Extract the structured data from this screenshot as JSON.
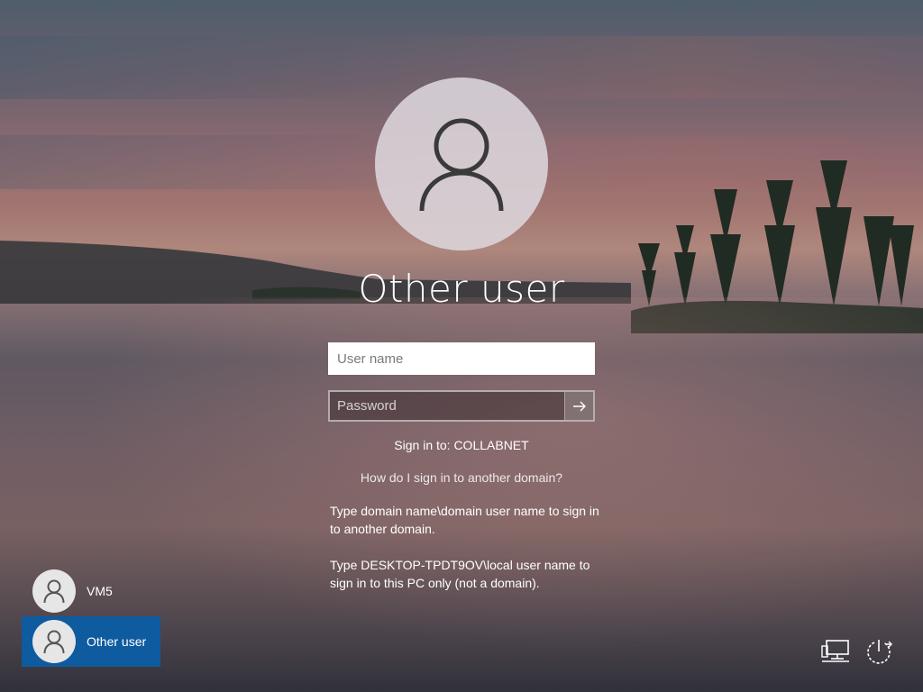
{
  "login": {
    "title": "Other user",
    "username_placeholder": "User name",
    "password_placeholder": "Password",
    "signin_to": "Sign in to: COLLABNET",
    "help_link": "How do I sign in to another domain?",
    "help_text_1": "Type domain name\\domain user name to sign in to another domain.",
    "help_text_2": "Type DESKTOP-TPDT9OV\\local user name to sign in to this PC only (not a domain)."
  },
  "users": [
    {
      "label": "VM5",
      "selected": false
    },
    {
      "label": "Other user",
      "selected": true
    }
  ],
  "icons": {
    "avatar": "user-silhouette-icon",
    "submit": "arrow-right-icon",
    "network": "network-icon",
    "power": "power-icon"
  },
  "colors": {
    "selected_tile": "#0f5ba0",
    "avatar_bg": "#dcd6dc"
  }
}
